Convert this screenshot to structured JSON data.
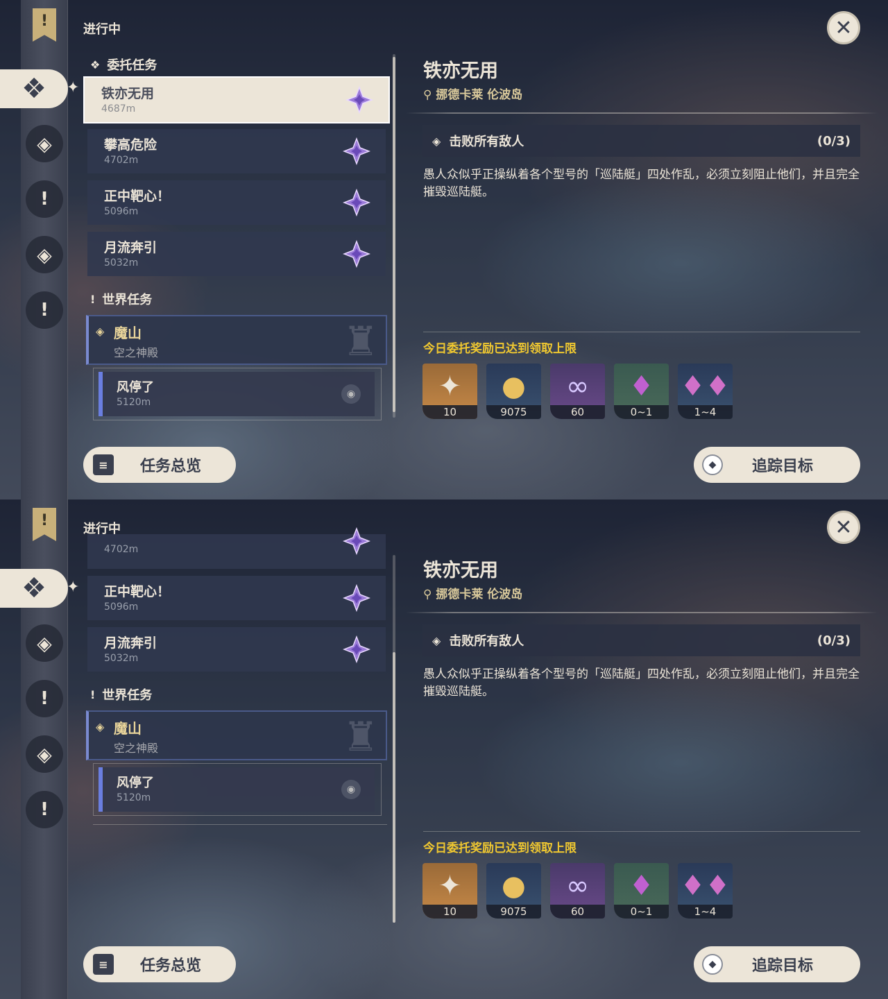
{
  "colors": {
    "accent": "#ece5d8",
    "gold_text": "#f0c830",
    "world_quest_gold": "#e8d49a",
    "dark": "#3a3f4e"
  },
  "icons": [
    "bookmark-icon",
    "commission-icon",
    "archon-quest-icon",
    "story-quest-icon",
    "world-quest-icon",
    "close-icon",
    "map-pin-icon",
    "objective-diamond-icon",
    "overview-icon",
    "track-icon"
  ],
  "header": {
    "label": "进行中"
  },
  "categories": {
    "commission": "委托任务",
    "world": "世界任务"
  },
  "commissions": [
    {
      "title": "铁亦无用",
      "distance": "4687m"
    },
    {
      "title": "攀高危险",
      "distance": "4702m"
    },
    {
      "title": "正中靶心！",
      "distance": "5096m"
    },
    {
      "title": "月流奔引",
      "distance": "5032m"
    }
  ],
  "world_quest": {
    "title": "魔山",
    "subtitle": "空之神殿"
  },
  "world_subquest": {
    "title": "风停了",
    "distance": "5120m"
  },
  "buttons": {
    "overview": "任务总览",
    "track": "追踪目标"
  },
  "detail": {
    "title": "铁亦无用",
    "location": "挪德卡莱 伦波岛",
    "objective": "击败所有敌人",
    "progress": "(0/3)",
    "description": "愚人众似乎正操纵着各个型号的「巡陆艇」四处作乱，必须立刻阻止他们，并且完全摧毁巡陆艇。",
    "reward_label": "今日委托奖励已达到领取上限",
    "rewards": [
      {
        "icon": "primogem-icon",
        "count": "10"
      },
      {
        "icon": "mora-icon",
        "count": "9075"
      },
      {
        "icon": "companionship-exp-icon",
        "count": "60"
      },
      {
        "icon": "crystal-icon",
        "count": "0~1"
      },
      {
        "icon": "crystal-cluster-icon",
        "count": "1~4"
      }
    ]
  }
}
